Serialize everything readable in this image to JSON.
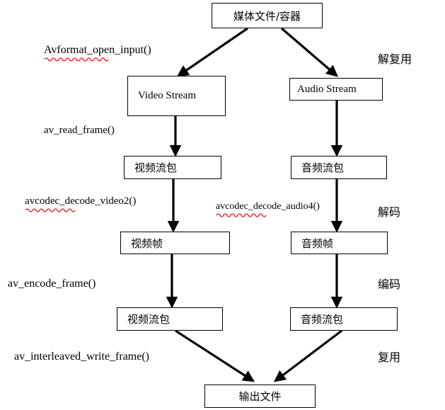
{
  "diagram": {
    "title": "FFmpeg media processing flow",
    "nodes": {
      "media_container": "媒体文件/容器",
      "video_stream": "Video Stream",
      "audio_stream": "Audio Stream",
      "video_packet_in": "视频流包",
      "audio_packet_in": "音频流包",
      "video_frame": "视频帧",
      "audio_frame": "音频帧",
      "video_packet_out": "视频流包",
      "audio_packet_out": "音频流包",
      "output_file": "输出文件"
    },
    "function_labels": {
      "open_input": "Avformat_open_input()",
      "read_frame": "av_read_frame()",
      "decode_video": "avcodec_decode_video2()",
      "decode_audio": "avcodec_decode_audio4()",
      "encode_frame": "av_encode_frame()",
      "write_frame": "av_interleaved_write_frame()"
    },
    "stage_labels": {
      "demux": "解复用",
      "decode": "解码",
      "encode": "编码",
      "mux": "复用"
    },
    "colors": {
      "stroke": "#000000",
      "background": "#ffffff",
      "spellcheck_underline": "#e01b1b"
    }
  }
}
